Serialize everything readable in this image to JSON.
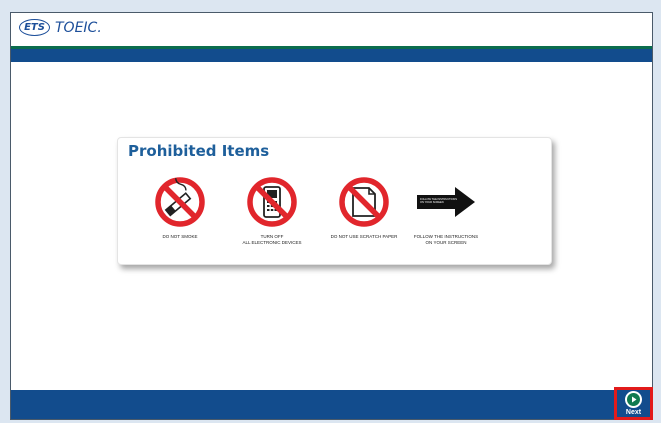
{
  "header": {
    "logo_ets": "ETS",
    "logo_product": "TOEIC."
  },
  "panel": {
    "title": "Prohibited Items",
    "items": [
      {
        "icon": "no-smoking-icon",
        "label": "DO NOT SMOKE"
      },
      {
        "icon": "no-phone-icon",
        "label": "TURN OFF\nALL ELECTRONIC DEVICES"
      },
      {
        "icon": "no-paper-icon",
        "label": "DO NOT USE SCRATCH PAPER"
      },
      {
        "icon": "arrow-right-icon",
        "arrow_text": "FOLLOW THE INSTRUCTIONS\nON YOUR SCREEN",
        "label": "FOLLOW THE INSTRUCTIONS\nON YOUR SCREEN"
      }
    ]
  },
  "footer": {
    "next_label": "Next"
  },
  "colors": {
    "page_bg": "#dce6f1",
    "bar_blue": "#124c8d",
    "accent_green": "#0b6d4e",
    "title_blue": "#1e5f9b",
    "prohibit_red": "#e1262c",
    "next_highlight": "#e21b1b"
  }
}
